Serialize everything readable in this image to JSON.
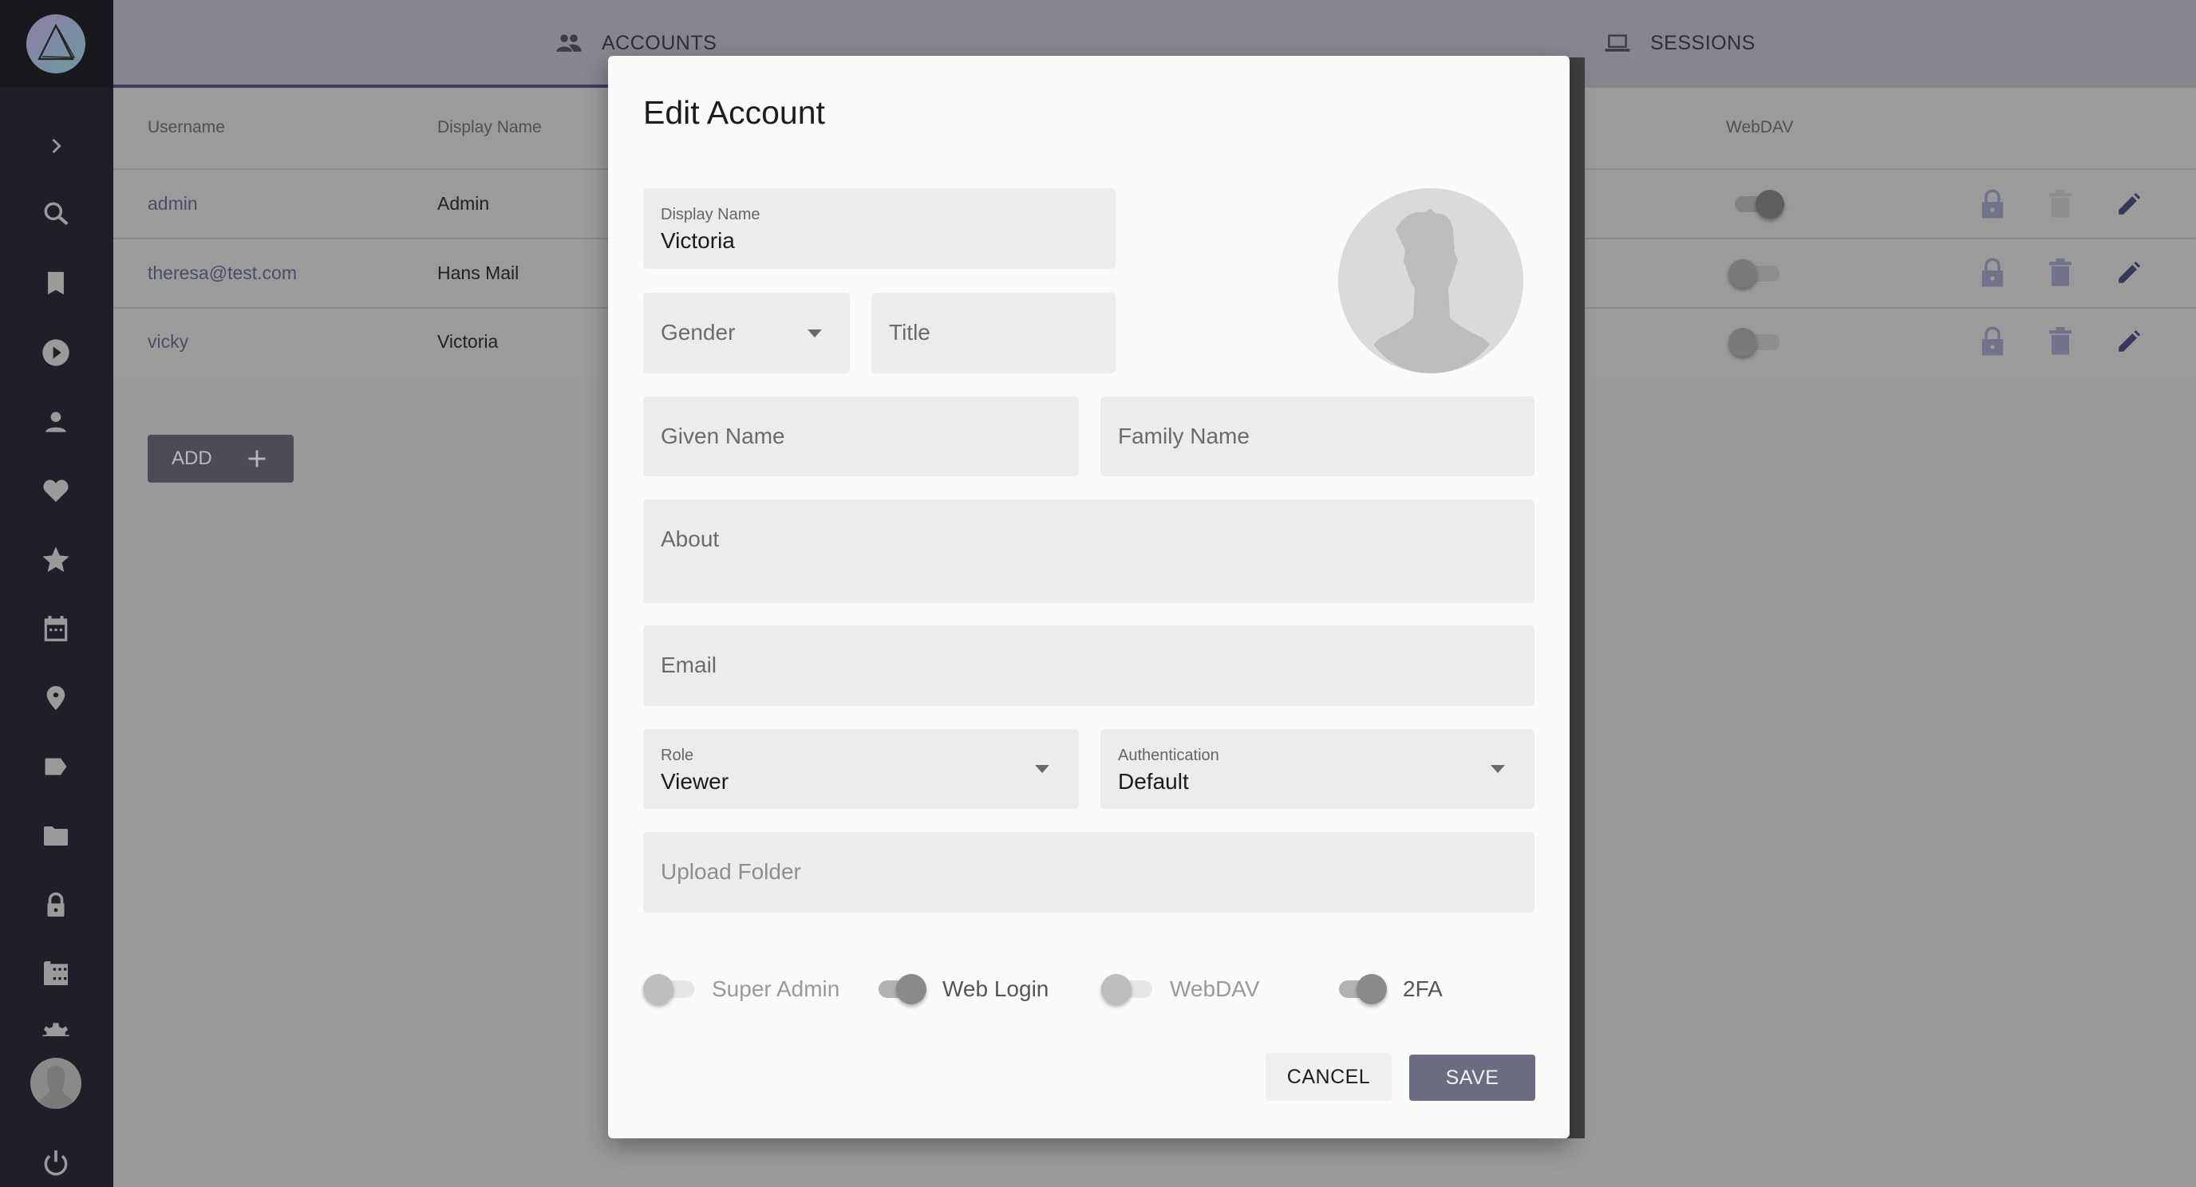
{
  "sidebar": {
    "logo": "photoprism-logo",
    "items": [
      {
        "icon": "chevron-right-icon",
        "label": "Expand"
      },
      {
        "icon": "search-icon",
        "label": "Search"
      },
      {
        "icon": "bookmark-icon",
        "label": "Albums"
      },
      {
        "icon": "play-circle-icon",
        "label": "Videos"
      },
      {
        "icon": "person-icon",
        "label": "People"
      },
      {
        "icon": "heart-icon",
        "label": "Favorites"
      },
      {
        "icon": "star-icon",
        "label": "Moments"
      },
      {
        "icon": "calendar-icon",
        "label": "Calendar"
      },
      {
        "icon": "map-pin-icon",
        "label": "Places"
      },
      {
        "icon": "label-icon",
        "label": "Labels"
      },
      {
        "icon": "folder-icon",
        "label": "Folders"
      },
      {
        "icon": "lock-icon",
        "label": "Private"
      },
      {
        "icon": "film-icon",
        "label": "Library"
      },
      {
        "icon": "settings-icon",
        "label": "Settings"
      }
    ],
    "power_icon": "power-icon"
  },
  "header": {
    "tabs": [
      {
        "label": "ACCOUNTS",
        "icon": "people-icon",
        "active": true
      },
      {
        "label": "SESSIONS",
        "icon": "laptop-icon",
        "active": false
      }
    ]
  },
  "table": {
    "columns": [
      "Username",
      "Display Name",
      "WebDAV"
    ],
    "rows": [
      {
        "username": "admin",
        "display_name": "Admin",
        "webdav": true,
        "delete_enabled": false
      },
      {
        "username": "theresa@test.com",
        "display_name": "Hans Mail",
        "webdav": false,
        "delete_enabled": true
      },
      {
        "username": "vicky",
        "display_name": "Victoria",
        "webdav": false,
        "delete_enabled": true
      }
    ],
    "add_label": "ADD"
  },
  "dialog": {
    "title": "Edit Account",
    "display_name": {
      "label": "Display Name",
      "value": "Victoria"
    },
    "gender": {
      "placeholder": "Gender"
    },
    "title_field": {
      "placeholder": "Title"
    },
    "given_name": {
      "placeholder": "Given Name"
    },
    "family_name": {
      "placeholder": "Family Name"
    },
    "about": {
      "placeholder": "About"
    },
    "email": {
      "placeholder": "Email"
    },
    "role": {
      "label": "Role",
      "value": "Viewer"
    },
    "authentication": {
      "label": "Authentication",
      "value": "Default"
    },
    "upload_folder": {
      "placeholder": "Upload Folder"
    },
    "switches": [
      {
        "label": "Super Admin",
        "on": false
      },
      {
        "label": "Web Login",
        "on": true
      },
      {
        "label": "WebDAV",
        "on": false
      },
      {
        "label": "2FA",
        "on": true
      }
    ],
    "cancel_label": "CANCEL",
    "save_label": "SAVE"
  },
  "colors": {
    "accent": "#3a3f5c",
    "save_button": "#6b6c82",
    "sidebar_bg": "#1f1f2a",
    "edit_icon": "#34385a"
  }
}
